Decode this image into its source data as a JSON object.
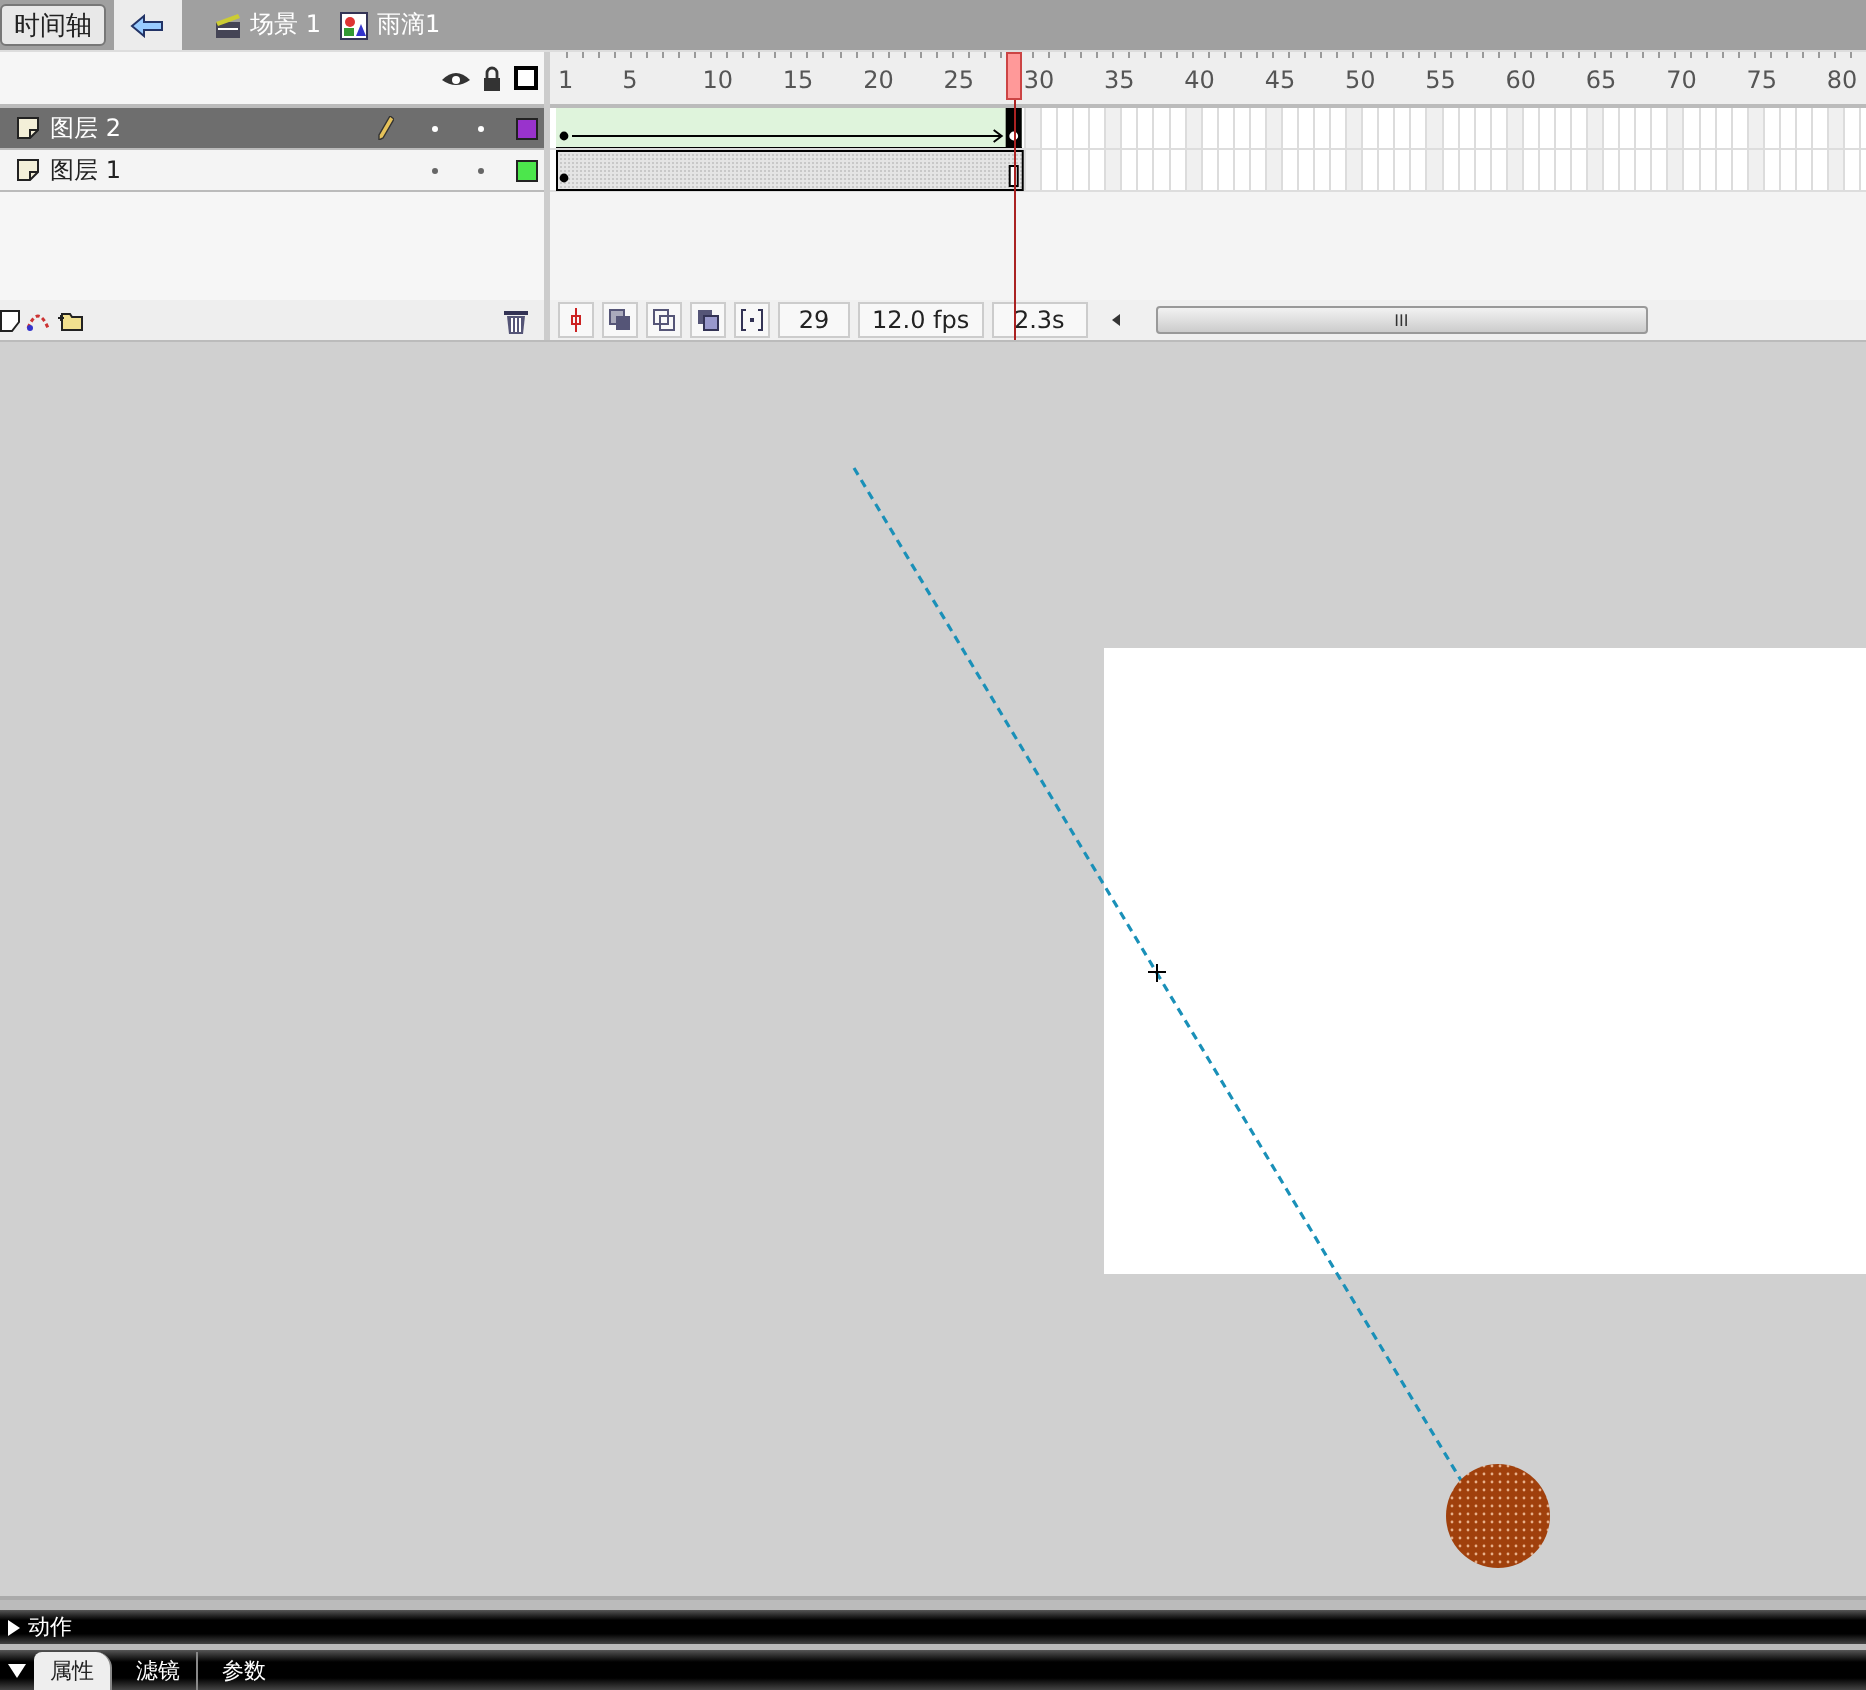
{
  "toolbar": {
    "timeline_button": "时间轴",
    "breadcrumbs": [
      {
        "kind": "scene",
        "label": "场景 1"
      },
      {
        "kind": "symbol",
        "label": "雨滴1"
      }
    ]
  },
  "ruler": [
    "1",
    "5",
    "10",
    "15",
    "20",
    "25",
    "30",
    "35",
    "40",
    "45",
    "50",
    "55",
    "60",
    "65",
    "70",
    "75",
    "80"
  ],
  "layers": [
    {
      "name": "图层 2",
      "selected": true,
      "editing": true,
      "visible": true,
      "locked": false,
      "color": "#9933cc",
      "kind": "tween"
    },
    {
      "name": "图层 1",
      "selected": false,
      "editing": false,
      "visible": true,
      "locked": false,
      "color": "#4ce64c",
      "kind": "static"
    }
  ],
  "status": {
    "frame": "29",
    "fps": "12.0 fps",
    "time": "2.3s",
    "scroll_glyph": "III"
  },
  "panels": {
    "actions": {
      "label": "动作",
      "expanded": false
    },
    "tabs": [
      {
        "label": "属性",
        "selected": true
      },
      {
        "label": "滤镜",
        "selected": false
      },
      {
        "label": "参数",
        "selected": false
      }
    ]
  }
}
